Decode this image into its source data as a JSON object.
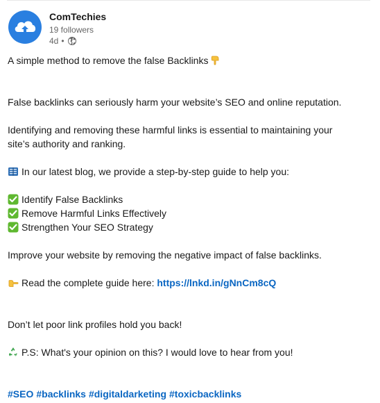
{
  "author": {
    "name": "ComTechies",
    "followers": "19 followers",
    "time": "4d",
    "separator": "•",
    "visibility_icon": "globe-icon",
    "avatar_icon": "cloud-upload-icon",
    "avatar_color": "#2a7fe0"
  },
  "post": {
    "title": "A simple method to remove the false Backlinks",
    "title_emoji": "pointing-down-emoji",
    "p1": "False backlinks can seriously harm your website’s SEO and online reputation.",
    "p2_line1": "Identifying and removing these harmful links is essential to maintaining your",
    "p2_line2": "site’s authority and ranking.",
    "p3": "In our latest blog, we provide a step-by-step guide to help you:",
    "p3_emoji": "blue-book-emoji",
    "checklist": [
      "Identify False Backlinks",
      "Remove Harmful Links Effectively",
      "Strengthen Your SEO Strategy"
    ],
    "checklist_emoji": "check-mark-button-emoji",
    "p4": "Improve your website by removing the negative impact of false backlinks.",
    "read_prefix": "Read the complete guide here: ",
    "read_link": "https://lnkd.in/gNnCm8cQ",
    "read_emoji": "pointing-right-emoji",
    "p5": "Don’t let poor link profiles hold you back!",
    "ps": "P.S: What's your opinion on this? I would love to hear from you!",
    "ps_emoji": "recycling-emoji",
    "hashtags": [
      "#SEO",
      "#backlinks",
      "#digitaldarketing",
      "#toxicbacklinks"
    ]
  },
  "colors": {
    "link": "#0a66c2",
    "text": "#191919",
    "muted": "#666666",
    "check": "#5fb830"
  }
}
